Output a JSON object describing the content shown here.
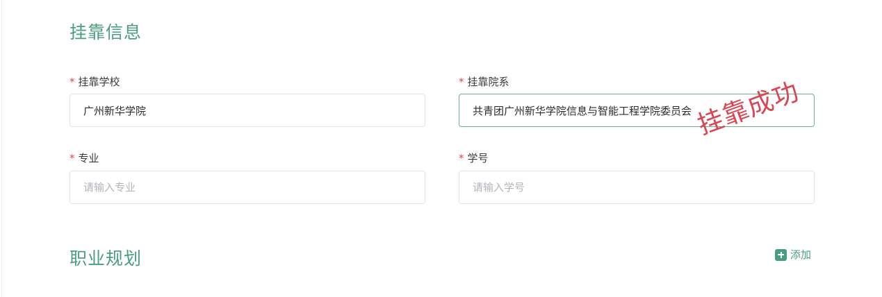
{
  "affiliation_section": {
    "title": "挂靠信息",
    "fields": {
      "school": {
        "required_mark": "*",
        "label": "挂靠学校",
        "value": "广州新华学院",
        "placeholder": ""
      },
      "department": {
        "required_mark": "*",
        "label": "挂靠院系",
        "value": "共青团广州新华学院信息与智能工程学院委员会",
        "placeholder": ""
      },
      "major": {
        "required_mark": "*",
        "label": "专业",
        "value": "",
        "placeholder": "请输入专业"
      },
      "student_id": {
        "required_mark": "*",
        "label": "学号",
        "value": "",
        "placeholder": "请输入学号"
      }
    },
    "stamp_text": "挂靠成功"
  },
  "career_section": {
    "title": "职业规划",
    "add_label": "添加"
  },
  "colors": {
    "accent": "#4a9e7e",
    "required": "#e04a3f",
    "stamp": "#d94654"
  }
}
